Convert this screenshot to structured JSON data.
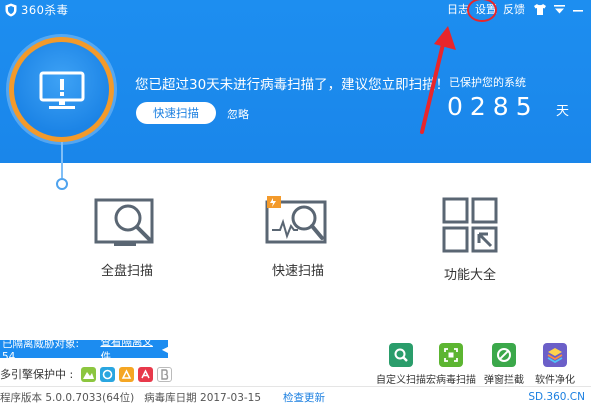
{
  "app": {
    "title": "360杀毒"
  },
  "topbar": {
    "log": "日志",
    "settings": "设置",
    "feedback": "反馈"
  },
  "status": {
    "warning": "您已超过30天未进行病毒扫描了，建议您立即扫描！",
    "quick_scan_button": "快速扫描",
    "ignore": "忽略",
    "protected_label": "已保护您的系统",
    "protected_days": "0285",
    "days_unit": "天"
  },
  "features": [
    {
      "label": "全盘扫描",
      "icon": "full-scan-icon"
    },
    {
      "label": "快速扫描",
      "icon": "quick-scan-icon"
    },
    {
      "label": "功能大全",
      "icon": "function-grid-icon"
    }
  ],
  "quarantine": {
    "text": "已隔离威胁对象: 54",
    "link": "查看隔离文件"
  },
  "engines": {
    "label": "多引擎保护中 :"
  },
  "tools": [
    {
      "label": "自定义扫描",
      "icon": "custom-scan-icon",
      "color": "#2a9d6b"
    },
    {
      "label": "宏病毒扫描",
      "icon": "macro-virus-icon",
      "color": "#5cb531"
    },
    {
      "label": "弹窗拦截",
      "icon": "popup-block-icon",
      "color": "#3ba84a"
    },
    {
      "label": "软件净化",
      "icon": "software-clean-icon",
      "color": "#6b5fc8"
    }
  ],
  "statusbar": {
    "program_version": "程序版本 5.0.0.7033(64位)",
    "db_date": "病毒库日期  2017-03-15",
    "check_update": "检查更新",
    "site": "SD.360.CN"
  },
  "colors": {
    "header": "#1d8ef0",
    "accent": "#1b7fe0",
    "ring": "#f39a2b",
    "annotation": "#e8262b"
  }
}
